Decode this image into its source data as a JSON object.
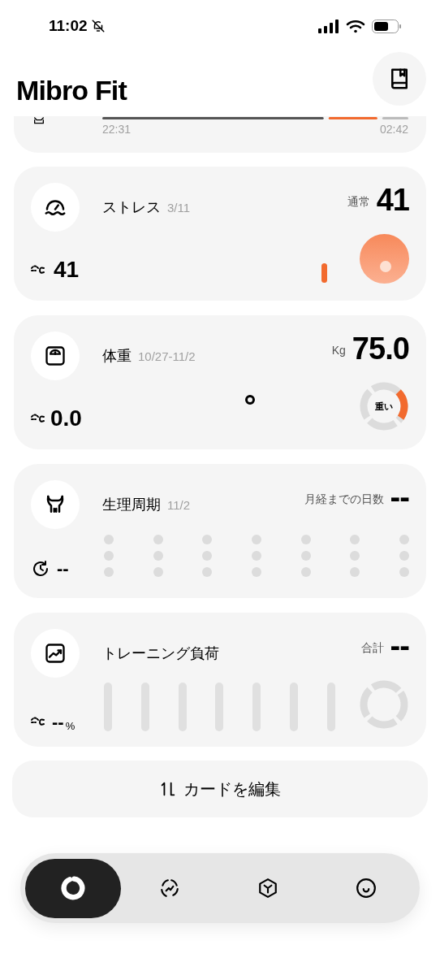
{
  "status_bar": {
    "time": "11:02"
  },
  "header": {
    "title": "Mibro Fit"
  },
  "sleep_card": {
    "start_time": "22:31",
    "end_time": "02:42"
  },
  "cards": [
    {
      "kind": "stress",
      "title": "ストレス",
      "date": "3/11",
      "status": "通常",
      "value": "41",
      "average": "41"
    },
    {
      "kind": "weight",
      "title": "体重",
      "date": "10/27-11/2",
      "unit": "Kg",
      "value": "75.0",
      "change": "0.0",
      "gauge_label": "重い"
    },
    {
      "kind": "cycle",
      "title": "生理周期",
      "date": "11/2",
      "label": "月経までの日数",
      "value": "--",
      "cycle_length": "--"
    },
    {
      "kind": "training",
      "title": "トレーニング負荷",
      "label": "合計",
      "value": "--",
      "change": "--",
      "change_unit": "%"
    }
  ],
  "edit_button": {
    "label": "カードを編集"
  },
  "nav": [
    {
      "selected": true
    },
    {
      "selected": false
    },
    {
      "selected": false
    },
    {
      "selected": false
    }
  ]
}
